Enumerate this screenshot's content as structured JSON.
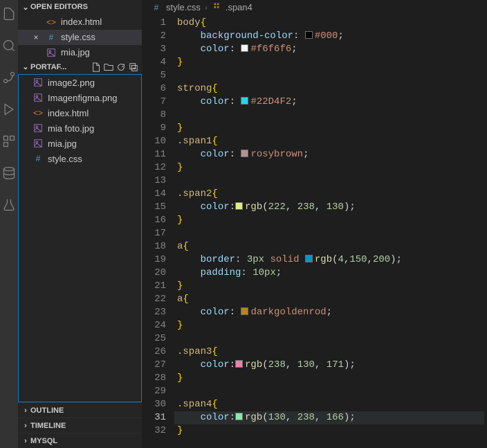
{
  "sections": {
    "openEditors": "OPEN EDITORS",
    "outline": "OUTLINE",
    "timeline": "TIMELINE",
    "mysql": "MYSQL"
  },
  "folder": {
    "name": "PORTAF..."
  },
  "openEditors": [
    {
      "name": "index.html",
      "icon": "html",
      "close": ""
    },
    {
      "name": "style.css",
      "icon": "css",
      "close": "×",
      "active": true
    },
    {
      "name": "mia.jpg",
      "icon": "img",
      "close": ""
    }
  ],
  "files": [
    {
      "name": "image2.png",
      "icon": "img"
    },
    {
      "name": "Imagenfigma.png",
      "icon": "img"
    },
    {
      "name": "index.html",
      "icon": "html"
    },
    {
      "name": "mia foto.jpg",
      "icon": "img"
    },
    {
      "name": "mia.jpg",
      "icon": "img"
    },
    {
      "name": "style.css",
      "icon": "css"
    }
  ],
  "breadcrumb": {
    "file": "style.css",
    "symbol": ".span4"
  },
  "code": {
    "lines": [
      {
        "n": 1,
        "t": "sel",
        "sel": "body",
        "open": "{"
      },
      {
        "n": 2,
        "t": "prop",
        "indent": "    ",
        "prop": "background-color",
        "swatch": "#000",
        "val": "#000",
        "end": ";"
      },
      {
        "n": 3,
        "t": "prop",
        "indent": "    ",
        "prop": "color",
        "swatch": "#f6f6f6",
        "val": "#f6f6f6",
        "end": ";"
      },
      {
        "n": 4,
        "t": "close"
      },
      {
        "n": 5,
        "t": "blank"
      },
      {
        "n": 6,
        "t": "sel",
        "sel": "strong",
        "open": "{"
      },
      {
        "n": 7,
        "t": "prop",
        "indent": "    ",
        "prop": "color",
        "swatch": "#22D4F2",
        "val": "#22D4F2",
        "end": ";"
      },
      {
        "n": 8,
        "t": "blank"
      },
      {
        "n": 9,
        "t": "close"
      },
      {
        "n": 10,
        "t": "sel",
        "sel": ".span1",
        "open": "{"
      },
      {
        "n": 11,
        "t": "prop",
        "indent": "    ",
        "prop": "color",
        "swatch": "#bc8f8f",
        "val": "rosybrown",
        "end": ";"
      },
      {
        "n": 12,
        "t": "close"
      },
      {
        "n": 13,
        "t": "blank"
      },
      {
        "n": 14,
        "t": "sel",
        "sel": ".span2",
        "open": "{"
      },
      {
        "n": 15,
        "t": "propfn",
        "indent": "    ",
        "prop": "color",
        "swatch": "rgb(222,238,130)",
        "fn": "rgb",
        "args": [
          "222",
          "238",
          "130"
        ],
        "end": ";"
      },
      {
        "n": 16,
        "t": "close"
      },
      {
        "n": 17,
        "t": "blank"
      },
      {
        "n": 18,
        "t": "sel",
        "sel": "a",
        "open": "{"
      },
      {
        "n": 19,
        "t": "propborder",
        "indent": "    ",
        "prop": "border",
        "px": "3px",
        "kw": "solid",
        "swatch": "rgb(4,150,200)",
        "fn": "rgb",
        "args": [
          "4",
          "150",
          "200"
        ],
        "end": ";"
      },
      {
        "n": 20,
        "t": "proppx",
        "indent": "    ",
        "prop": "padding",
        "px": "10px",
        "end": ";"
      },
      {
        "n": 21,
        "t": "close"
      },
      {
        "n": 22,
        "t": "sel",
        "sel": "a",
        "open": "{"
      },
      {
        "n": 23,
        "t": "prop",
        "indent": "    ",
        "prop": "color",
        "swatch": "#b8860b",
        "val": "darkgoldenrod",
        "end": ";"
      },
      {
        "n": 24,
        "t": "close"
      },
      {
        "n": 25,
        "t": "blank"
      },
      {
        "n": 26,
        "t": "sel",
        "sel": ".span3",
        "open": "{"
      },
      {
        "n": 27,
        "t": "propfn",
        "indent": "    ",
        "prop": "color",
        "swatch": "rgb(238,130,171)",
        "fn": "rgb",
        "args": [
          "238",
          "130",
          "171"
        ],
        "end": ";"
      },
      {
        "n": 28,
        "t": "close"
      },
      {
        "n": 29,
        "t": "blank"
      },
      {
        "n": 30,
        "t": "sel",
        "sel": ".span4",
        "open": "{"
      },
      {
        "n": 31,
        "t": "propfn",
        "indent": "    ",
        "prop": "color",
        "swatch": "rgb(130,238,166)",
        "fn": "rgb",
        "args": [
          "130",
          "238",
          "166"
        ],
        "end": ";",
        "active": true
      },
      {
        "n": 32,
        "t": "close"
      }
    ]
  }
}
